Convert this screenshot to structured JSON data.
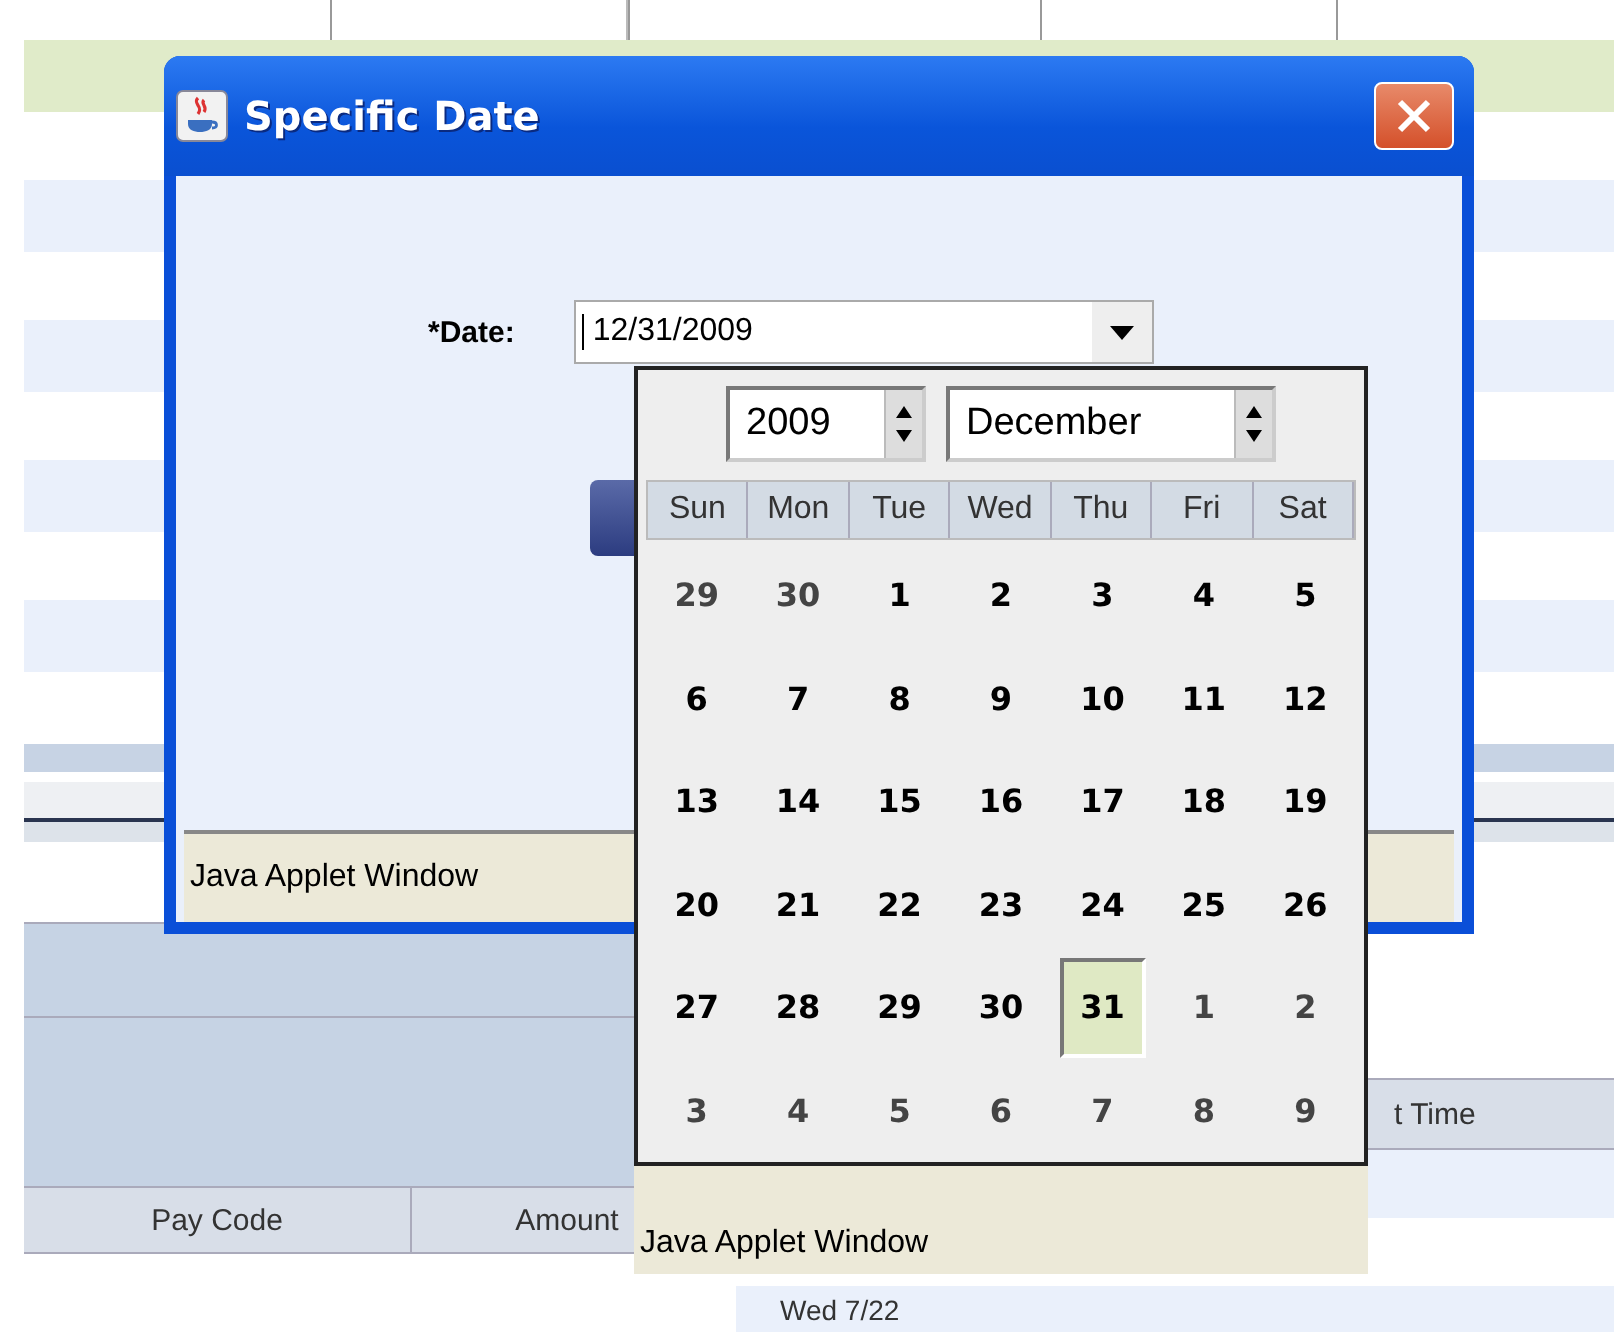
{
  "lower_table": {
    "columns": [
      "Pay Code",
      "Amount"
    ]
  },
  "right_table": {
    "columns": [
      "t Time"
    ],
    "rows": [
      {
        "cells": [
          "Wed 7/22"
        ]
      }
    ]
  },
  "dialog": {
    "title": "Specific Date",
    "date_label": "*Date:",
    "date_value": "12/31/2009",
    "footer": "Java Applet Window"
  },
  "calendar": {
    "year": "2009",
    "month": "December",
    "weekdays": [
      "Sun",
      "Mon",
      "Tue",
      "Wed",
      "Thu",
      "Fri",
      "Sat"
    ],
    "weeks": [
      [
        {
          "day": "29",
          "in_month": false,
          "selected": false
        },
        {
          "day": "30",
          "in_month": false,
          "selected": false
        },
        {
          "day": "1",
          "in_month": true,
          "selected": false
        },
        {
          "day": "2",
          "in_month": true,
          "selected": false
        },
        {
          "day": "3",
          "in_month": true,
          "selected": false
        },
        {
          "day": "4",
          "in_month": true,
          "selected": false
        },
        {
          "day": "5",
          "in_month": true,
          "selected": false
        }
      ],
      [
        {
          "day": "6",
          "in_month": true,
          "selected": false
        },
        {
          "day": "7",
          "in_month": true,
          "selected": false
        },
        {
          "day": "8",
          "in_month": true,
          "selected": false
        },
        {
          "day": "9",
          "in_month": true,
          "selected": false
        },
        {
          "day": "10",
          "in_month": true,
          "selected": false
        },
        {
          "day": "11",
          "in_month": true,
          "selected": false
        },
        {
          "day": "12",
          "in_month": true,
          "selected": false
        }
      ],
      [
        {
          "day": "13",
          "in_month": true,
          "selected": false
        },
        {
          "day": "14",
          "in_month": true,
          "selected": false
        },
        {
          "day": "15",
          "in_month": true,
          "selected": false
        },
        {
          "day": "16",
          "in_month": true,
          "selected": false
        },
        {
          "day": "17",
          "in_month": true,
          "selected": false
        },
        {
          "day": "18",
          "in_month": true,
          "selected": false
        },
        {
          "day": "19",
          "in_month": true,
          "selected": false
        }
      ],
      [
        {
          "day": "20",
          "in_month": true,
          "selected": false
        },
        {
          "day": "21",
          "in_month": true,
          "selected": false
        },
        {
          "day": "22",
          "in_month": true,
          "selected": false
        },
        {
          "day": "23",
          "in_month": true,
          "selected": false
        },
        {
          "day": "24",
          "in_month": true,
          "selected": false
        },
        {
          "day": "25",
          "in_month": true,
          "selected": false
        },
        {
          "day": "26",
          "in_month": true,
          "selected": false
        }
      ],
      [
        {
          "day": "27",
          "in_month": true,
          "selected": false
        },
        {
          "day": "28",
          "in_month": true,
          "selected": false
        },
        {
          "day": "29",
          "in_month": true,
          "selected": false
        },
        {
          "day": "30",
          "in_month": true,
          "selected": false
        },
        {
          "day": "31",
          "in_month": true,
          "selected": true
        },
        {
          "day": "1",
          "in_month": false,
          "selected": false
        },
        {
          "day": "2",
          "in_month": false,
          "selected": false
        }
      ],
      [
        {
          "day": "3",
          "in_month": false,
          "selected": false
        },
        {
          "day": "4",
          "in_month": false,
          "selected": false
        },
        {
          "day": "5",
          "in_month": false,
          "selected": false
        },
        {
          "day": "6",
          "in_month": false,
          "selected": false
        },
        {
          "day": "7",
          "in_month": false,
          "selected": false
        },
        {
          "day": "8",
          "in_month": false,
          "selected": false
        },
        {
          "day": "9",
          "in_month": false,
          "selected": false
        }
      ]
    ],
    "footer": "Java Applet Window"
  }
}
